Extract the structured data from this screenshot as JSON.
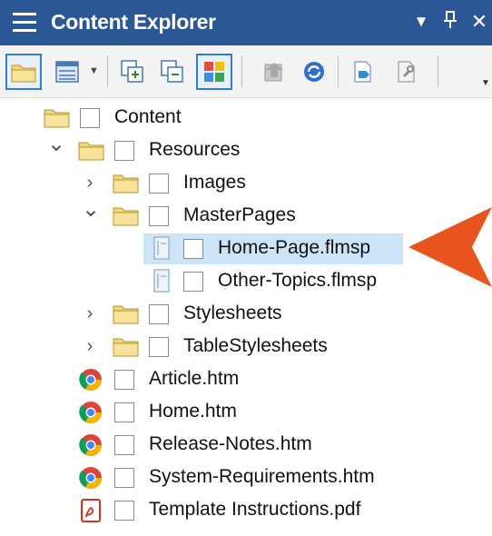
{
  "panel": {
    "title": "Content Explorer",
    "dropdown_glyph": "▼",
    "pin_glyph": "⊥",
    "close_glyph": "✕"
  },
  "toolbar": {
    "buttons": [
      {
        "name": "folder-view-button",
        "icon": "folder-icon",
        "active": true
      },
      {
        "name": "list-view-button",
        "icon": "list-view-icon",
        "active": false
      },
      {
        "name": "expand-all-button",
        "icon": "expand-all-icon",
        "active": false
      },
      {
        "name": "collapse-all-button",
        "icon": "collapse-all-icon",
        "active": false
      },
      {
        "name": "color-view-button",
        "icon": "color-grid-icon",
        "active": true
      },
      {
        "name": "import-button",
        "icon": "import-icon",
        "active": false
      },
      {
        "name": "refresh-button",
        "icon": "refresh-icon",
        "active": false
      },
      {
        "name": "open-button",
        "icon": "open-doc-icon",
        "active": false
      },
      {
        "name": "properties-button",
        "icon": "properties-icon",
        "active": false
      }
    ]
  },
  "tree": {
    "items": [
      {
        "label": "Content",
        "type": "folder",
        "level": 0,
        "expander": "",
        "selected": false
      },
      {
        "label": "Resources",
        "type": "folder",
        "level": 1,
        "expander": "open",
        "selected": false
      },
      {
        "label": "Images",
        "type": "folder",
        "level": 2,
        "expander": "closed",
        "selected": false
      },
      {
        "label": "MasterPages",
        "type": "folder",
        "level": 2,
        "expander": "open",
        "selected": false
      },
      {
        "label": "Home-Page.flmsp",
        "type": "masterpage",
        "level": 3,
        "expander": "",
        "selected": true
      },
      {
        "label": "Other-Topics.flmsp",
        "type": "masterpage",
        "level": 3,
        "expander": "",
        "selected": false
      },
      {
        "label": "Stylesheets",
        "type": "folder",
        "level": 2,
        "expander": "closed",
        "selected": false
      },
      {
        "label": "TableStylesheets",
        "type": "folder",
        "level": 2,
        "expander": "closed",
        "selected": false
      },
      {
        "label": "Article.htm",
        "type": "htm",
        "level": 1,
        "expander": "",
        "selected": false
      },
      {
        "label": "Home.htm",
        "type": "htm",
        "level": 1,
        "expander": "",
        "selected": false
      },
      {
        "label": "Release-Notes.htm",
        "type": "htm",
        "level": 1,
        "expander": "",
        "selected": false
      },
      {
        "label": "System-Requirements.htm",
        "type": "htm",
        "level": 1,
        "expander": "",
        "selected": false
      },
      {
        "label": "Template Instructions.pdf",
        "type": "pdf",
        "level": 1,
        "expander": "",
        "selected": false
      }
    ]
  },
  "colors": {
    "titlebar": "#2b5797",
    "selection": "#cce4f7",
    "callout_arrow": "#e8541e",
    "folder": "#f2d67a"
  }
}
